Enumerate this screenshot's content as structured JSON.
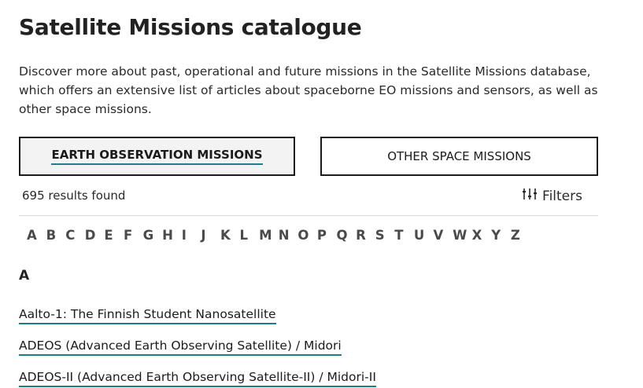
{
  "page": {
    "title": "Satellite Missions catalogue",
    "intro": "Discover more about past, operational and future missions in the Satellite Missions database, which offers an extensive list of articles about spaceborne EO missions and sensors, as well as other space missions."
  },
  "tabs": {
    "earth_observation": "EARTH OBSERVATION MISSIONS",
    "other_space": "OTHER SPACE MISSIONS"
  },
  "results": {
    "count_text": "695 results found",
    "filters_label": "Filters",
    "filters_icon": "sliders-icon"
  },
  "alphabet": [
    "A",
    "B",
    "C",
    "D",
    "E",
    "F",
    "G",
    "H",
    "I",
    "J",
    "K",
    "L",
    "M",
    "N",
    "O",
    "P",
    "Q",
    "R",
    "S",
    "T",
    "U",
    "V",
    "W",
    "X",
    "Y",
    "Z"
  ],
  "section": {
    "letter": "A",
    "missions": [
      "Aalto-1: The Finnish Student Nanosatellite",
      "ADEOS (Advanced Earth Observing Satellite) / Midori",
      "ADEOS-II (Advanced Earth Observing Satellite-II) / Midori-II"
    ]
  },
  "colors": {
    "accent_underline": "#1d7f86",
    "active_tab_bg": "#f3f3f3"
  }
}
